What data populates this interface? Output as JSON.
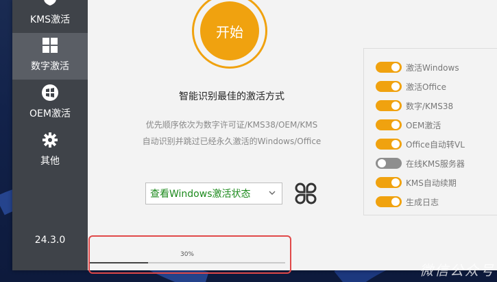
{
  "sidebar": {
    "items": [
      {
        "label": "KMS激活",
        "icon": "shield-icon"
      },
      {
        "label": "数字激活",
        "icon": "windows-icon",
        "active": true
      },
      {
        "label": "OEM激活",
        "icon": "windows-logo-icon"
      },
      {
        "label": "其他",
        "icon": "gear-icon"
      }
    ],
    "version": "24.3.0"
  },
  "main": {
    "start_label": "开始",
    "heading": "智能识别最佳的激活方式",
    "desc_line1": "优先顺序依次为数字许可证/KMS38/OEM/KMS",
    "desc_line2": "自动识别并跳过已经永久激活的Windows/Office",
    "dropdown_value": "查看Windows激活状态",
    "progress": {
      "text": "30%",
      "value": 0.3
    }
  },
  "options": [
    {
      "label": "激活Windows",
      "on": true
    },
    {
      "label": "激活Office",
      "on": true
    },
    {
      "label": "数字/KMS38",
      "on": true
    },
    {
      "label": "OEM激活",
      "on": true
    },
    {
      "label": "Office自动转VL",
      "on": true
    },
    {
      "label": "在线KMS服务器",
      "on": false
    },
    {
      "label": "KMS自动续期",
      "on": true
    },
    {
      "label": "生成日志",
      "on": true
    }
  ],
  "watermark": "微信公众号",
  "colors": {
    "accent": "#f0a20f",
    "sidebar": "#3f4349",
    "sidebar_active": "#5a5e65",
    "highlight": "#e04848"
  }
}
